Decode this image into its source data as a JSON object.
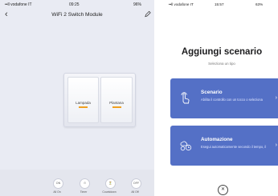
{
  "left": {
    "status": {
      "carrier": "••ll vodafone IT",
      "time": "09:25",
      "battery": "96%"
    },
    "header": {
      "title": "WiFi 2 Switch Module",
      "back_icon": "chevron-left-icon",
      "edit_icon": "pencil-icon"
    },
    "switches": [
      {
        "label": "Lampada"
      },
      {
        "label": "Plantana"
      }
    ],
    "bottom_buttons": [
      {
        "glyph": "ON",
        "label": "All On"
      },
      {
        "glyph": "⏱",
        "label": "Timer"
      },
      {
        "glyph": "⏳",
        "label": "Countdown"
      },
      {
        "glyph": "OFF",
        "label": "All Off"
      }
    ],
    "colors": {
      "accent": "#f0a020",
      "background": "#e9ebf3"
    }
  },
  "right": {
    "status": {
      "carrier": "••ll vodafone IT",
      "time": "15:57",
      "battery": "63%"
    },
    "title": "Aggiungi scenario",
    "subtitle": "Seleziona un tipo",
    "cards": [
      {
        "title": "Scenario",
        "description": "Abilita il controllo con un tocco o seleziona",
        "icon": "tap-icon"
      },
      {
        "title": "Automazione",
        "description": "Esegui automaticamente secondo il tempo, il",
        "icon": "weather-clock-icon"
      }
    ],
    "close_icon": "close-icon",
    "colors": {
      "card": "#5470c6"
    }
  }
}
